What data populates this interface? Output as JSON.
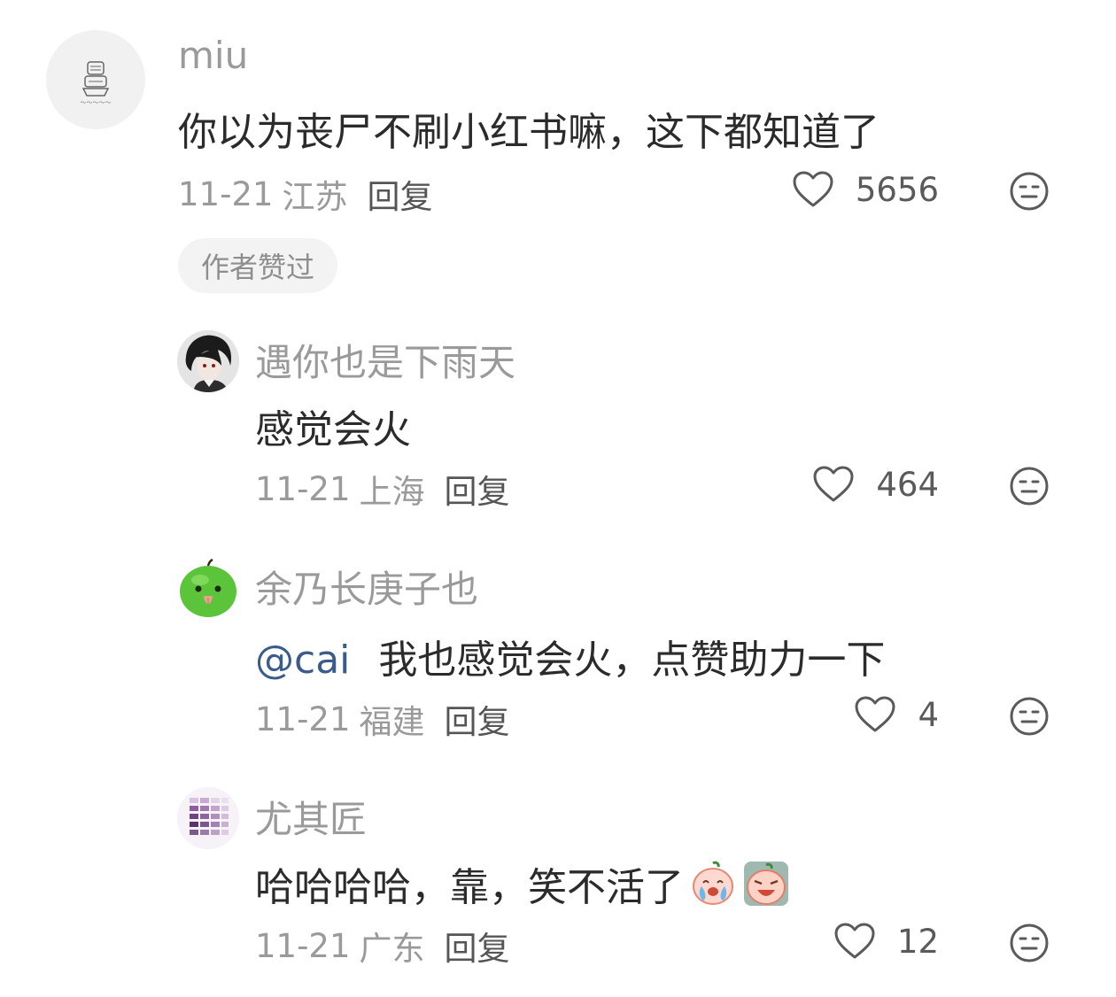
{
  "comments": [
    {
      "username": "miu",
      "text": "你以为丧尸不刷小红书嘛，这下都知道了",
      "date": "11-21",
      "location": "江苏",
      "reply_label": "回复",
      "likes": "5656",
      "badge": "作者赞过",
      "avatar_icon": "sketch-logo-avatar"
    },
    {
      "username": "遇你也是下雨天",
      "text": "感觉会火",
      "date": "11-21",
      "location": "上海",
      "reply_label": "回复",
      "likes": "464",
      "avatar_icon": "anime-boy-avatar"
    },
    {
      "username": "余乃长庚子也",
      "mention": "@cai",
      "text": "我也感觉会火，点赞助力一下",
      "date": "11-21",
      "location": "福建",
      "reply_label": "回复",
      "likes": "4",
      "avatar_icon": "green-apple-avatar"
    },
    {
      "username": "尤其匠",
      "text": "哈哈哈哈，靠，笑不活了",
      "date": "11-21",
      "location": "广东",
      "reply_label": "回复",
      "likes": "12",
      "avatar_icon": "purple-palette-avatar",
      "emojis": [
        "crying-peach-emoji",
        "laughing-peach-emoji"
      ]
    }
  ],
  "colors": {
    "secondary_text": "#9a9a9a",
    "primary_text": "#2b2b2b",
    "mention": "#3b5b8a",
    "badge_bg": "#f3f3f3"
  }
}
